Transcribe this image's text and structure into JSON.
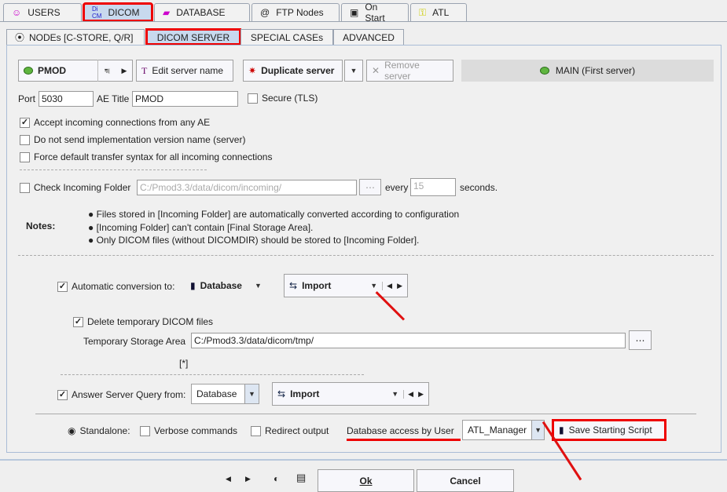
{
  "tabs": [
    {
      "label": "USERS",
      "icon": "users-icon"
    },
    {
      "label": "DICOM",
      "icon": "dicom-icon",
      "selected": true
    },
    {
      "label": "DATABASE",
      "icon": "database-icon"
    },
    {
      "label": "FTP Nodes",
      "icon": "at-icon"
    },
    {
      "label": "On Start",
      "icon": "clipboard-icon"
    },
    {
      "label": "ATL",
      "icon": "key-icon"
    }
  ],
  "subtabs": [
    {
      "label": "NODEs [C-STORE, Q/R]"
    },
    {
      "label": "DICOM SERVER",
      "selected": true
    },
    {
      "label": "SPECIAL CASEs"
    },
    {
      "label": "ADVANCED"
    }
  ],
  "server": {
    "name": "PMOD",
    "edit_label": "Edit server name",
    "duplicate_label": "Duplicate server",
    "remove_label": "Remove server",
    "main_label": "MAIN (First server)",
    "port_label": "Port",
    "port": "5030",
    "ae_label": "AE Title",
    "ae": "PMOD",
    "secure_label": "Secure (TLS)"
  },
  "options": {
    "accept_any": "Accept incoming connections from any AE",
    "no_version": "Do not send implementation version name (server)",
    "force_syntax": "Force default transfer syntax for all incoming connections"
  },
  "incoming": {
    "label": "Check Incoming Folder",
    "path": "C:/Pmod3.3/data/dicom/incoming/",
    "every_label": "every",
    "every": "15",
    "seconds_label": "seconds."
  },
  "notes": {
    "label": "Notes:",
    "items": [
      "Files stored in [Incoming Folder] are automatically converted according to configuration",
      "[Incoming Folder] can't contain [Final Storage Area].",
      "Only DICOM files (without DICOMDIR) should be stored to [Incoming Folder]."
    ]
  },
  "conversion": {
    "label": "Automatic conversion to:",
    "target": "Database",
    "mode": "Import",
    "delete_tmp": "Delete temporary DICOM files",
    "tmp_label": "Temporary Storage Area",
    "tmp_path": "C:/Pmod3.3/data/dicom/tmp/",
    "marker": "[*]"
  },
  "query": {
    "label": "Answer Server Query from:",
    "source": "Database",
    "mode": "Import"
  },
  "bottom": {
    "standalone": "Standalone:",
    "verbose": "Verbose commands",
    "redirect": "Redirect output",
    "db_user_label": "Database access by User",
    "db_user": "ATL_Manager",
    "save_script": "Save Starting Script"
  },
  "footer": {
    "ok": "Ok",
    "cancel": "Cancel"
  },
  "colors": {
    "highlight": "#e00000",
    "selected_tab": "#c8d9ee",
    "server_dot": "#5fb53f"
  }
}
